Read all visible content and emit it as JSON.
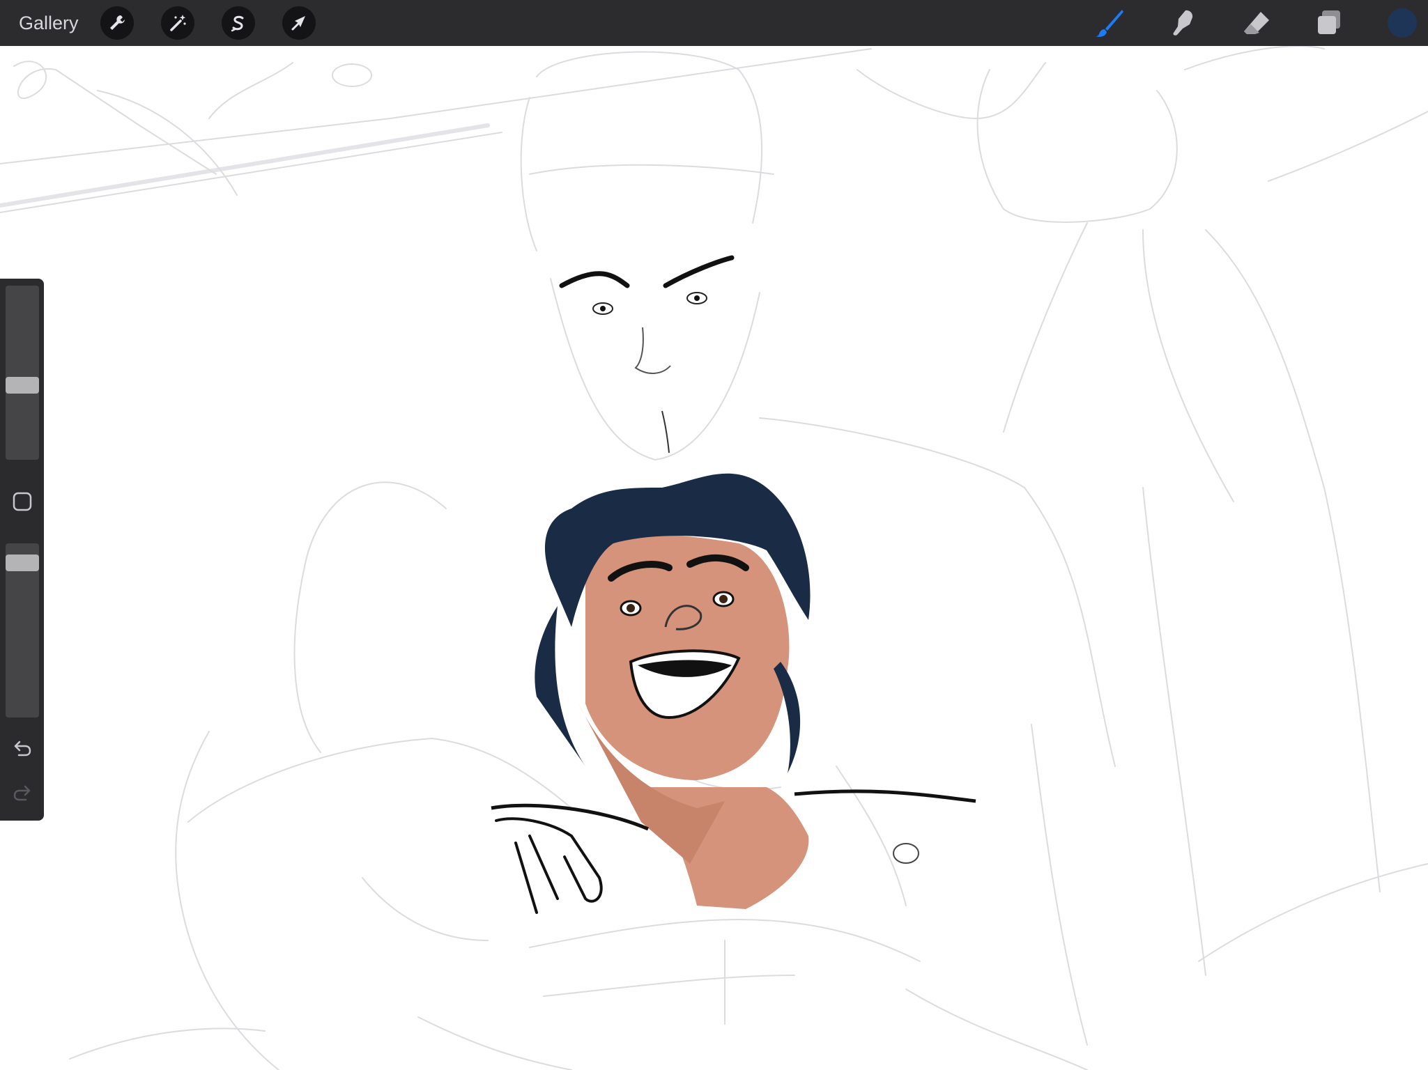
{
  "app": {
    "gallery_label": "Gallery"
  },
  "toolbar_left": [
    {
      "name": "actions",
      "icon": "wrench-icon"
    },
    {
      "name": "adjustments",
      "icon": "magic-wand-icon"
    },
    {
      "name": "selection",
      "icon": "selection-s-icon"
    },
    {
      "name": "transform",
      "icon": "transform-arrow-icon"
    }
  ],
  "toolbar_right": [
    {
      "name": "brush",
      "icon": "brush-icon",
      "active": true
    },
    {
      "name": "smudge",
      "icon": "smudge-icon",
      "active": false
    },
    {
      "name": "eraser",
      "icon": "eraser-icon",
      "active": false
    },
    {
      "name": "layers",
      "icon": "layers-icon",
      "active": false
    }
  ],
  "colors": {
    "topbar": "#2c2c2e",
    "active_tool": "#1e7bf6",
    "inactive_tool": "#c7c7cc",
    "current_color": "#1e3557",
    "canvas": "#ffffff",
    "sketch": "#d9d9de",
    "hair": "#1a2b45",
    "skin": "#d4937a",
    "ink": "#111111"
  },
  "sidebar": {
    "brush_size_level": 0.42,
    "opacity_level": 0.93,
    "modify_button_icon": "square-modify-icon",
    "undo_icon": "undo-icon",
    "redo_icon": "redo-icon",
    "redo_enabled": false
  },
  "canvas_content": "illustration-sketch"
}
